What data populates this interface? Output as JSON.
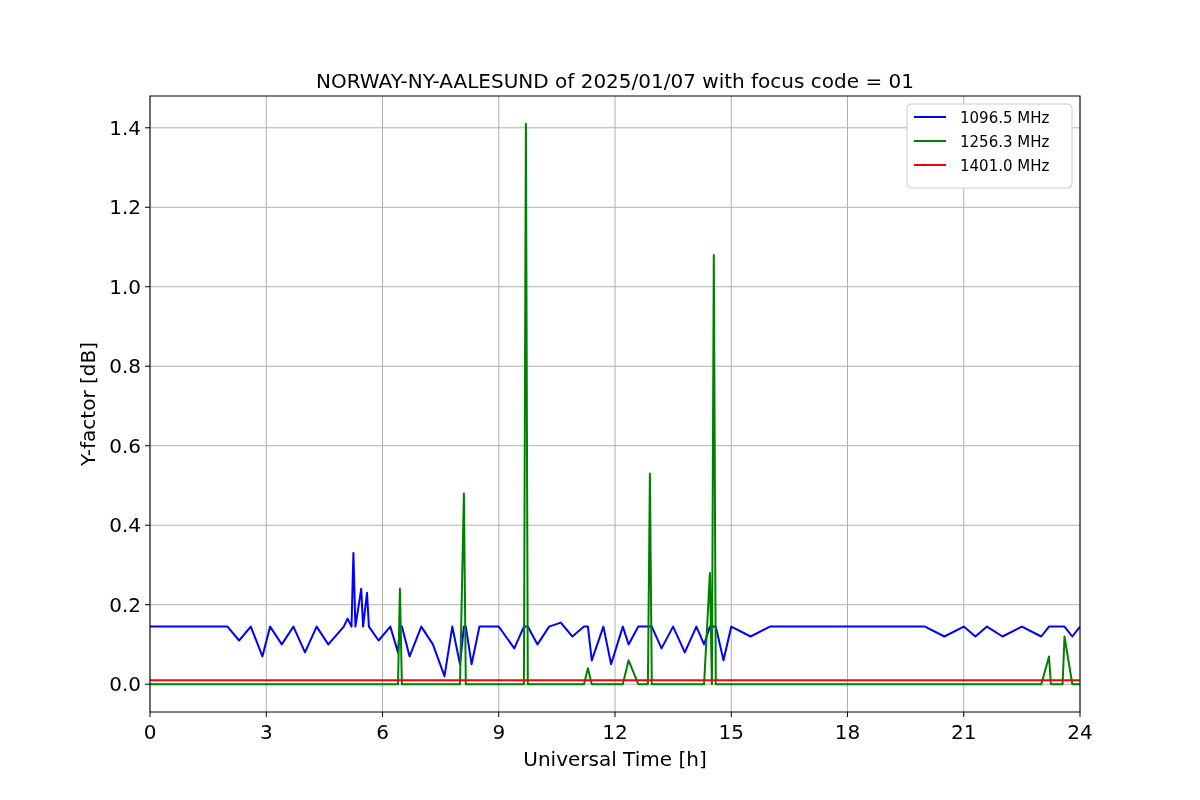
{
  "chart_data": {
    "type": "line",
    "title": "NORWAY-NY-AALESUND of 2025/01/07 with focus code = 01",
    "xlabel": "Universal Time [h]",
    "ylabel": "Y-factor [dB]",
    "x": [
      0,
      1,
      2,
      2.3,
      2.6,
      2.9,
      3.1,
      3.4,
      3.7,
      4,
      4.3,
      4.6,
      5,
      5.1,
      5.2,
      5.25,
      5.3,
      5.45,
      5.5,
      5.6,
      5.65,
      5.9,
      6.2,
      6.4,
      6.45,
      6.5,
      6.7,
      7,
      7.3,
      7.6,
      7.8,
      8,
      8.1,
      8.15,
      8.3,
      8.5,
      9,
      9.4,
      9.65,
      9.7,
      9.75,
      10,
      10.3,
      10.6,
      10.9,
      11.2,
      11.3,
      11.4,
      11.7,
      11.9,
      12.2,
      12.35,
      12.6,
      12.85,
      12.9,
      12.95,
      13.2,
      13.5,
      13.8,
      14.1,
      14.3,
      14.45,
      14.5,
      14.55,
      14.6,
      14.8,
      15,
      15.5,
      16,
      18,
      20,
      20.5,
      21,
      21.3,
      21.6,
      22,
      22.5,
      23,
      23.2,
      23.25,
      23.55,
      23.6,
      23.8,
      24
    ],
    "series": [
      {
        "name": "1096.5 MHz",
        "color": "#0000ff",
        "values": [
          0.145,
          0.145,
          0.145,
          0.11,
          0.145,
          0.07,
          0.145,
          0.1,
          0.145,
          0.08,
          0.145,
          0.1,
          0.145,
          0.165,
          0.145,
          0.33,
          0.145,
          0.24,
          0.145,
          0.23,
          0.145,
          0.11,
          0.145,
          0.08,
          0.145,
          0.145,
          0.07,
          0.145,
          0.1,
          0.02,
          0.145,
          0.05,
          0.145,
          0.145,
          0.05,
          0.145,
          0.145,
          0.09,
          0.145,
          0.145,
          0.145,
          0.1,
          0.145,
          0.155,
          0.12,
          0.145,
          0.145,
          0.06,
          0.145,
          0.05,
          0.145,
          0.1,
          0.145,
          0.145,
          0.145,
          0.145,
          0.09,
          0.145,
          0.08,
          0.145,
          0.1,
          0.145,
          0.145,
          0.145,
          0.145,
          0.06,
          0.145,
          0.12,
          0.145,
          0.145,
          0.145,
          0.12,
          0.145,
          0.12,
          0.145,
          0.12,
          0.145,
          0.12,
          0.145,
          0.145,
          0.145,
          0.145,
          0.12,
          0.145
        ]
      },
      {
        "name": "1256.3 MHz",
        "color": "#008000",
        "values": [
          0,
          0,
          0,
          0,
          0,
          0,
          0,
          0,
          0,
          0,
          0,
          0,
          0,
          0,
          0,
          0,
          0,
          0,
          0,
          0,
          0,
          0,
          0,
          0,
          0.24,
          0,
          0,
          0,
          0,
          0,
          0,
          0,
          0.48,
          0,
          0,
          0,
          0,
          0,
          0,
          1.41,
          0,
          0,
          0,
          0,
          0,
          0,
          0.04,
          0,
          0,
          0,
          0,
          0.06,
          0,
          0,
          0.53,
          0,
          0,
          0,
          0,
          0,
          0,
          0.28,
          0,
          1.08,
          0,
          0,
          0,
          0,
          0,
          0,
          0,
          0,
          0,
          0,
          0,
          0,
          0,
          0,
          0.07,
          0,
          0,
          0.12,
          0,
          0
        ]
      },
      {
        "name": "1401.0 MHz",
        "color": "#ff0000",
        "values": [
          0.01,
          0.01,
          0.01,
          0.01,
          0.01,
          0.01,
          0.01,
          0.01,
          0.01,
          0.01,
          0.01,
          0.01,
          0.01,
          0.01,
          0.01,
          0.01,
          0.01,
          0.01,
          0.01,
          0.01,
          0.01,
          0.01,
          0.01,
          0.01,
          0.01,
          0.01,
          0.01,
          0.01,
          0.01,
          0.01,
          0.01,
          0.01,
          0.01,
          0.01,
          0.01,
          0.01,
          0.01,
          0.01,
          0.01,
          0.01,
          0.01,
          0.01,
          0.01,
          0.01,
          0.01,
          0.01,
          0.01,
          0.01,
          0.01,
          0.01,
          0.01,
          0.01,
          0.01,
          0.01,
          0.01,
          0.01,
          0.01,
          0.01,
          0.01,
          0.01,
          0.01,
          0.01,
          0.01,
          0.01,
          0.01,
          0.01,
          0.01,
          0.01,
          0.01,
          0.01,
          0.01,
          0.01,
          0.01,
          0.01,
          0.01,
          0.01,
          0.01,
          0.01,
          0.01,
          0.01,
          0.01,
          0.01,
          0.01,
          0.01
        ]
      }
    ],
    "grid": true,
    "legend": true,
    "xlim": [
      0,
      24
    ],
    "ylim": [
      -0.07,
      1.48
    ],
    "xticks": [
      0,
      3,
      6,
      9,
      12,
      15,
      18,
      21,
      24
    ],
    "yticks": [
      {
        "value": 0,
        "label": "0.0"
      },
      {
        "value": 0.2,
        "label": "0.2"
      },
      {
        "value": 0.4,
        "label": "0.4"
      },
      {
        "value": 0.6,
        "label": "0.6"
      },
      {
        "value": 0.8,
        "label": "0.8"
      },
      {
        "value": 1.0,
        "label": "1.0"
      },
      {
        "value": 1.2,
        "label": "1.2"
      },
      {
        "value": 1.4,
        "label": "1.4"
      }
    ]
  }
}
